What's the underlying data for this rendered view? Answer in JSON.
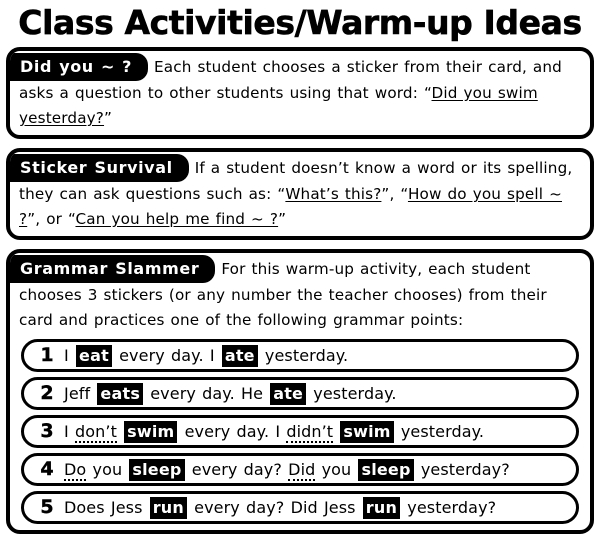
{
  "page": {
    "title": "Class Activities/Warm-up Ideas"
  },
  "sections": [
    {
      "tab_label": "Did you ~ ?",
      "text_parts": [
        {
          "text": "Each student chooses a sticker from their card, and asks a question to other students using that word: ",
          "underline": false
        },
        {
          "text": "“",
          "underline": false
        },
        {
          "text": "Did you swim yesterday?",
          "underline": true
        },
        {
          "text": "”",
          "underline": false
        }
      ]
    },
    {
      "tab_label": "Sticker Survival",
      "text_parts": [
        {
          "text": "If a student doesn’t know a word or its spelling, they can ask questions such as: “",
          "underline": false
        },
        {
          "text": "What’s this?",
          "underline": true
        },
        {
          "text": "”, “",
          "underline": false
        },
        {
          "text": "How do you spell ~ ?",
          "underline": true
        },
        {
          "text": "”, or “",
          "underline": false
        },
        {
          "text": "Can you help me find ~ ?",
          "underline": true
        },
        {
          "text": "”",
          "underline": false
        }
      ]
    },
    {
      "tab_label": "Grammar Slammer",
      "text_parts": [
        {
          "text": "For this warm-up activity, each student chooses 3 stickers (or any number the teacher chooses) from their card and practices one of the following grammar points:",
          "underline": false
        }
      ]
    }
  ],
  "grammar_items": [
    {
      "number": "1",
      "parts": [
        {
          "text": "I ",
          "style": "plain"
        },
        {
          "text": "eat",
          "style": "highlight"
        },
        {
          "text": " every day. I ",
          "style": "plain"
        },
        {
          "text": "ate",
          "style": "highlight"
        },
        {
          "text": " yesterday.",
          "style": "plain"
        }
      ]
    },
    {
      "number": "2",
      "parts": [
        {
          "text": "Jeff ",
          "style": "plain"
        },
        {
          "text": "eats",
          "style": "highlight"
        },
        {
          "text": " every day. He ",
          "style": "plain"
        },
        {
          "text": "ate",
          "style": "highlight"
        },
        {
          "text": " yesterday.",
          "style": "plain"
        }
      ]
    },
    {
      "number": "3",
      "parts": [
        {
          "text": "I ",
          "style": "plain"
        },
        {
          "text": "don’t",
          "style": "dotted"
        },
        {
          "text": " ",
          "style": "plain"
        },
        {
          "text": "swim",
          "style": "highlight"
        },
        {
          "text": " every day. I ",
          "style": "plain"
        },
        {
          "text": "didn’t",
          "style": "dotted"
        },
        {
          "text": " ",
          "style": "plain"
        },
        {
          "text": "swim",
          "style": "highlight"
        },
        {
          "text": " yesterday.",
          "style": "plain"
        }
      ]
    },
    {
      "number": "4",
      "parts": [
        {
          "text": "Do",
          "style": "dotted"
        },
        {
          "text": " you ",
          "style": "plain"
        },
        {
          "text": "sleep",
          "style": "highlight"
        },
        {
          "text": " every day? ",
          "style": "plain"
        },
        {
          "text": "Did",
          "style": "dotted"
        },
        {
          "text": " you ",
          "style": "plain"
        },
        {
          "text": "sleep",
          "style": "highlight"
        },
        {
          "text": " yesterday?",
          "style": "plain"
        }
      ]
    },
    {
      "number": "5",
      "parts": [
        {
          "text": "Does Jess ",
          "style": "plain"
        },
        {
          "text": "run",
          "style": "highlight"
        },
        {
          "text": " every day? Did Jess ",
          "style": "plain"
        },
        {
          "text": "run",
          "style": "highlight"
        },
        {
          "text": " yesterday?",
          "style": "plain"
        }
      ]
    }
  ],
  "colors": {
    "ink": "#000000",
    "paper": "#ffffff"
  }
}
